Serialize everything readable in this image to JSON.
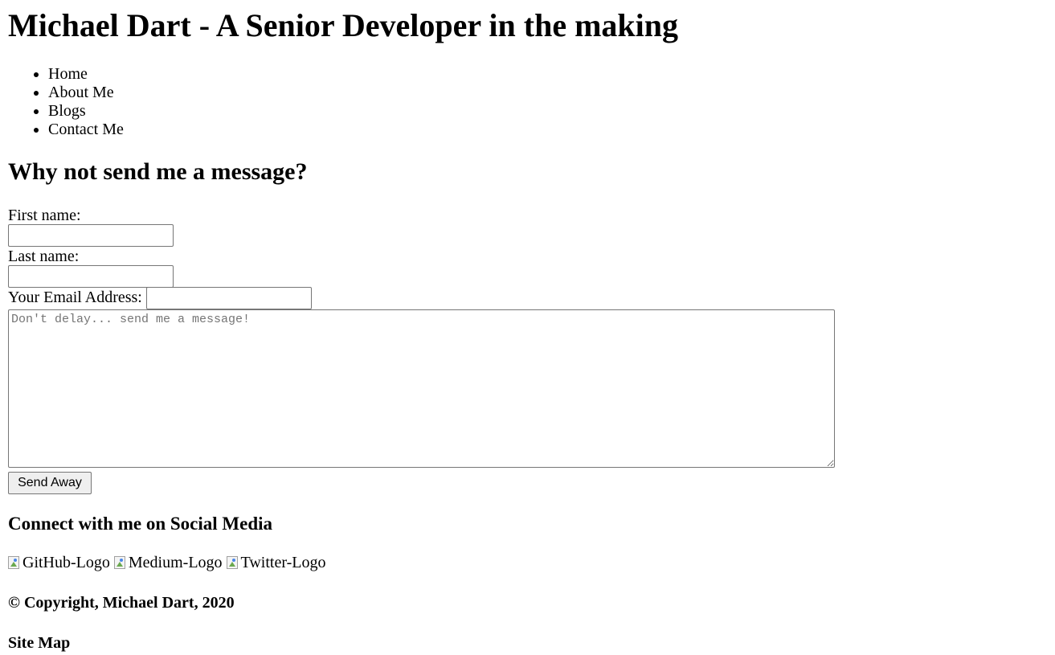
{
  "header": {
    "title": "Michael Dart - A Senior Developer in the making"
  },
  "nav": {
    "items": [
      {
        "label": "Home"
      },
      {
        "label": "About Me"
      },
      {
        "label": "Blogs"
      },
      {
        "label": "Contact Me"
      }
    ]
  },
  "contact": {
    "heading": "Why not send me a message?",
    "first_name_label": "First name:",
    "first_name_value": "",
    "last_name_label": "Last name:",
    "last_name_value": "",
    "email_label": "Your Email Address:",
    "email_value": "",
    "message_placeholder": "Don't delay... send me a message!",
    "submit_label": "Send Away"
  },
  "social": {
    "heading": "Connect with me on Social Media",
    "logos": [
      {
        "alt": "GitHub-Logo",
        "icon": "broken-image-icon"
      },
      {
        "alt": "Medium-Logo",
        "icon": "broken-image-icon"
      },
      {
        "alt": "Twitter-Logo",
        "icon": "broken-image-icon"
      }
    ]
  },
  "footer": {
    "copyright": "© Copyright, Michael Dart, 2020",
    "sitemap": "Site Map"
  }
}
